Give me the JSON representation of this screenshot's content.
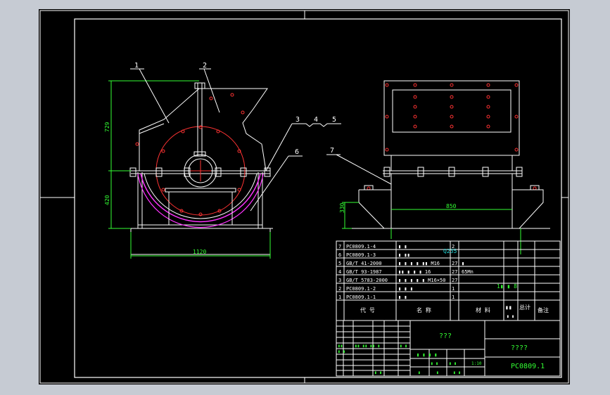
{
  "balloons": [
    "1",
    "2",
    "3",
    "4",
    "5",
    "6",
    "7"
  ],
  "dimensions": {
    "side_height_upper": "729",
    "side_height_lower": "420",
    "base_width": "1120",
    "front_width": "850",
    "front_height": "330"
  },
  "parts_list": [
    {
      "no": "7",
      "code": "PC0809.1-4",
      "name": "▮ ▮",
      "qty": "2",
      "material": "",
      "extra": "Q235"
    },
    {
      "no": "6",
      "code": "PC0809.1-3",
      "name": "▮ ▮▮",
      "qty": "",
      "material": "",
      "extra": ""
    },
    {
      "no": "5",
      "code": "GB/T 41-2000",
      "name": "▮ ▮ ▮ ▮ ▮▮ M16",
      "qty": "27",
      "material": "▮",
      "extra": ""
    },
    {
      "no": "4",
      "code": "GB/T 93-1987",
      "name": "▮▮ ▮ ▮ ▮ 16",
      "qty": "27",
      "material": "65Mn",
      "extra": ""
    },
    {
      "no": "3",
      "code": "GB/T 5783-2000",
      "name": "▮ ▮ ▮ ▮ ▮ M16×50",
      "qty": "27",
      "material": "",
      "extra": ""
    },
    {
      "no": "2",
      "code": "PC0809.1-2",
      "name": "▮ ▮ ▮",
      "qty": "1",
      "material": "",
      "extra": ""
    },
    {
      "no": "1",
      "code": "PC0809.1-1",
      "name": "▮ ▮",
      "qty": "1",
      "material": "",
      "extra": ""
    }
  ],
  "parts_header": {
    "code": "代 号",
    "name": "名 称",
    "material": "材 料",
    "weight": "▮▮",
    "total": "总计",
    "note": "备注",
    "unit": "▮ ▮"
  },
  "sheet_note": "1▮ ▮ 8",
  "title_block": {
    "center_title": "???",
    "org": "????",
    "drawing_no": "PC0809.1",
    "scale": "1:10",
    "stage_labels": "▮ ▮ ▮ ▮",
    "left_labels": [
      "▮▮",
      "▮ ▮",
      "▮▮ ▮▮ ▮▮ ▮",
      "▮ ▮"
    ],
    "bottom_labels": [
      "▮ ▮",
      "▮",
      "▮",
      "▮ ▮"
    ],
    "count_labels": [
      "▮ ▮",
      "▮ ▮"
    ]
  },
  "colors": {
    "background": "#c6cbd3",
    "paper": "#000000",
    "line": "#ffffff",
    "hidden": "#ff3333",
    "dimension": "#33ff33",
    "arc": "#ff33ff",
    "text": "#ffffff"
  }
}
